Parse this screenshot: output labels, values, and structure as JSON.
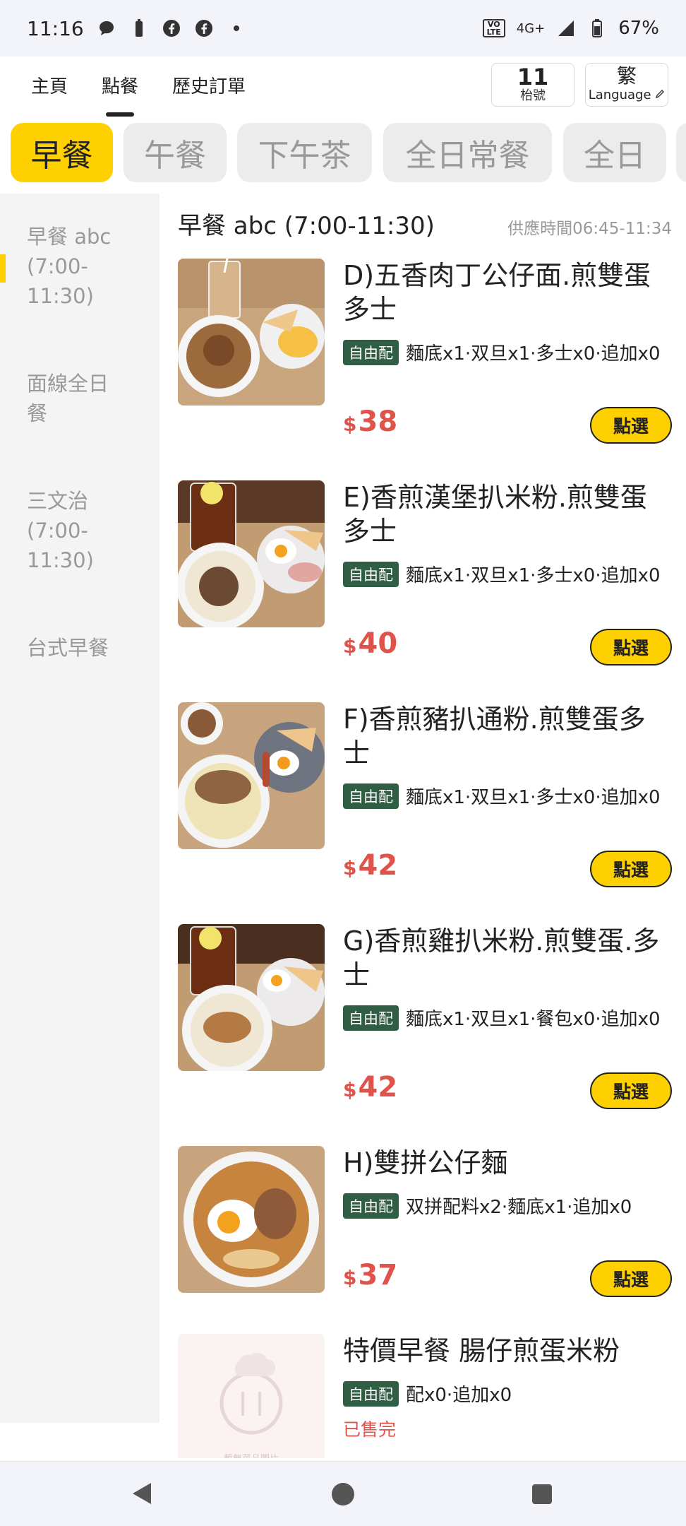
{
  "status_bar": {
    "time": "11:16",
    "network": "4G+",
    "volte": "VO LTE",
    "battery": "67%"
  },
  "top_nav": {
    "tabs": [
      {
        "label": "主頁",
        "active": false
      },
      {
        "label": "點餐",
        "active": true
      },
      {
        "label": "歷史訂單",
        "active": false
      }
    ],
    "ticket_number": "11",
    "ticket_label": "枱號",
    "lang_main": "繁",
    "lang_sub": "Language"
  },
  "categories": [
    {
      "label": "早餐",
      "active": true
    },
    {
      "label": "午餐",
      "active": false
    },
    {
      "label": "下午茶",
      "active": false
    },
    {
      "label": "全日常餐",
      "active": false
    },
    {
      "label": "全日",
      "active": false
    }
  ],
  "sidebar": {
    "items": [
      {
        "label": "早餐 abc\n(7:00-\n11:30)",
        "active": true
      },
      {
        "label": "面線全日\n餐",
        "active": false
      },
      {
        "label": "三文治\n(7:00-\n11:30)",
        "active": false
      },
      {
        "label": "台式早餐",
        "active": false
      }
    ]
  },
  "section": {
    "title": "早餐 abc (7:00-11:30)",
    "hours": "供應時間06:45-11:34"
  },
  "dishes": [
    {
      "name": "D)五香肉丁公仔面.煎雙蛋多士",
      "tag": "自由配",
      "desc": "麵底x1·双旦x1·多士x0·追加x0",
      "currency": "$",
      "price": "38",
      "button": "點選"
    },
    {
      "name": "E)香煎漢堡扒米粉.煎雙蛋多士",
      "tag": "自由配",
      "desc": "麵底x1·双旦x1·多士x0·追加x0",
      "currency": "$",
      "price": "40",
      "button": "點選"
    },
    {
      "name": "F)香煎豬扒通粉.煎雙蛋多士",
      "tag": "自由配",
      "desc": "麵底x1·双旦x1·多士x0·追加x0",
      "currency": "$",
      "price": "42",
      "button": "點選"
    },
    {
      "name": "G)香煎雞扒米粉.煎雙蛋.多士",
      "tag": "自由配",
      "desc": "麵底x1·双旦x1·餐包x0·追加x0",
      "currency": "$",
      "price": "42",
      "button": "點選"
    },
    {
      "name": "H)雙拼公仔麵",
      "tag": "自由配",
      "desc": "双拼配料x2·麵底x1·追加x0",
      "currency": "$",
      "price": "37",
      "button": "點選"
    },
    {
      "name": "特價早餐 腸仔煎蛋米粉",
      "tag": "自由配",
      "desc": "配x0·追加x0",
      "soldout": "已售完",
      "placeholder_caption": "暫無菜品圖片"
    }
  ]
}
